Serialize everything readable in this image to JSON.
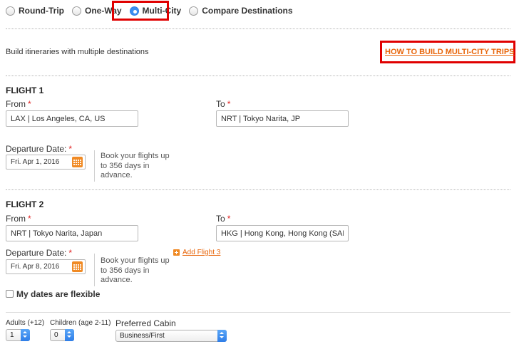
{
  "trip_types": {
    "options": [
      "Round-Trip",
      "One-Way",
      "Multi-City",
      "Compare Destinations"
    ],
    "selected": "Multi-City"
  },
  "intro": {
    "text": "Build itineraries with multiple destinations",
    "how_to_link": "HOW TO BUILD MULTI-CITY TRIPS"
  },
  "labels": {
    "from": "From",
    "to": "To",
    "departure_date": "Departure Date:",
    "required_mark": "*",
    "note": "Book your flights up to 356 days in advance."
  },
  "flights": [
    {
      "title": "FLIGHT 1",
      "from": "LAX | Los Angeles, CA, US",
      "to": "NRT | Tokyo Narita, JP",
      "date": "Fri. Apr 1, 2016"
    },
    {
      "title": "FLIGHT 2",
      "from": "NRT | Tokyo Narita, Japan",
      "to": "HKG | Hong Kong, Hong Kong (SAR)",
      "date": "Fri. Apr 8, 2016"
    }
  ],
  "add_flight": "Add Flight 3",
  "flexible_dates": {
    "label": "My dates are flexible",
    "checked": false
  },
  "passengers": {
    "adults_label": "Adults (+12)",
    "adults_value": "1",
    "children_label": "Children (age 2-11)",
    "children_value": "0",
    "cabin_label": "Preferred Cabin",
    "cabin_value": "Business/First"
  },
  "colors": {
    "accent_orange": "#e8650a",
    "highlight_red": "#e00000",
    "radio_blue": "#3b8ef0"
  }
}
